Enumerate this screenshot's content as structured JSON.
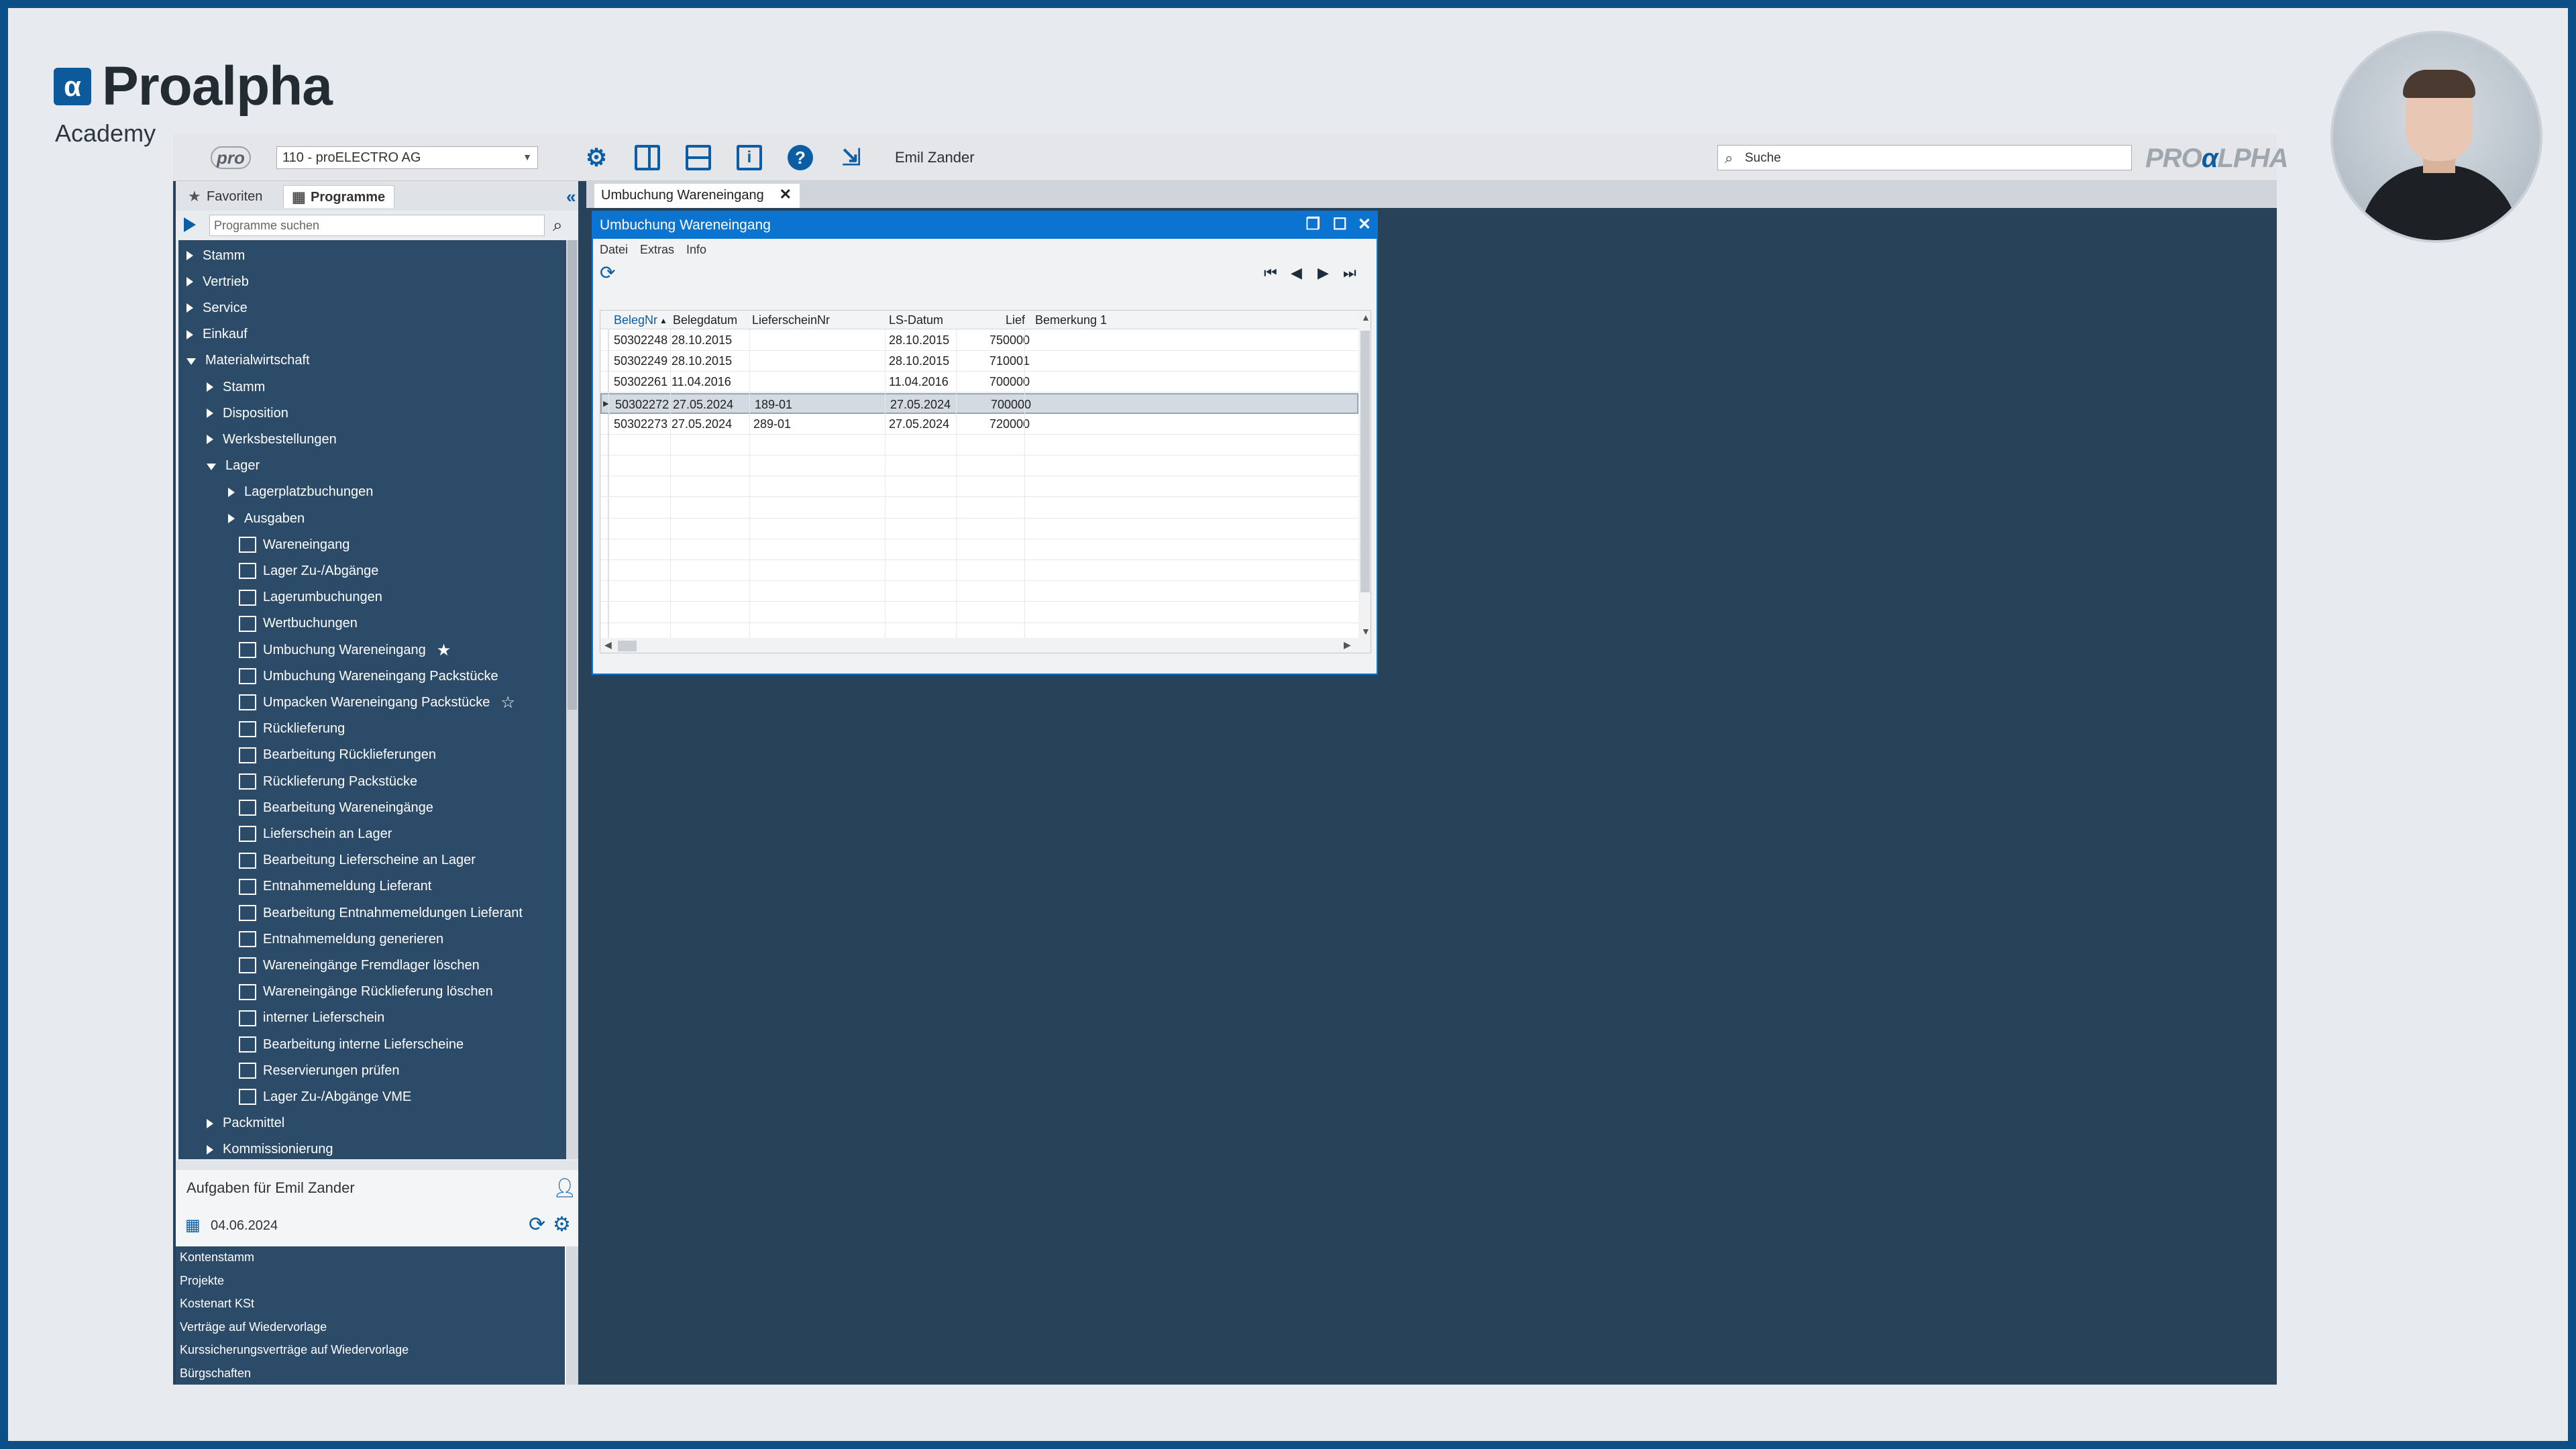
{
  "branding": {
    "logo_mark": "α",
    "logo_text": "Proalpha",
    "logo_subtitle": "Academy"
  },
  "topbar": {
    "pro_badge": "pro",
    "company_select": "110 - proELECTRO AG",
    "user_name": "Emil Zander",
    "search_placeholder": "Suche",
    "brand_left": "PRO",
    "brand_mid": "α",
    "brand_right": "LPHA",
    "icons": [
      "gear-icon",
      "panel-icon",
      "layout-icon",
      "info-icon",
      "help-icon",
      "exit-icon"
    ]
  },
  "left_panel": {
    "tab_favorites": "Favoriten",
    "tab_programs": "Programme",
    "search_placeholder": "Programme suchen",
    "tree": [
      {
        "label": "Stamm",
        "level": 0,
        "state": "collapsed"
      },
      {
        "label": "Vertrieb",
        "level": 0,
        "state": "collapsed"
      },
      {
        "label": "Service",
        "level": 0,
        "state": "collapsed"
      },
      {
        "label": "Einkauf",
        "level": 0,
        "state": "collapsed"
      },
      {
        "label": "Materialwirtschaft",
        "level": 0,
        "state": "expanded"
      },
      {
        "label": "Stamm",
        "level": 1,
        "state": "collapsed"
      },
      {
        "label": "Disposition",
        "level": 1,
        "state": "collapsed"
      },
      {
        "label": "Werksbestellungen",
        "level": 1,
        "state": "collapsed"
      },
      {
        "label": "Lager",
        "level": 1,
        "state": "expanded"
      },
      {
        "label": "Lagerplatzbuchungen",
        "level": 2,
        "state": "collapsed"
      },
      {
        "label": "Ausgaben",
        "level": 2,
        "state": "collapsed"
      },
      {
        "label": "Wareneingang",
        "level": 3,
        "state": "leaf"
      },
      {
        "label": "Lager Zu-/Abgänge",
        "level": 3,
        "state": "leaf"
      },
      {
        "label": "Lagerumbuchungen",
        "level": 3,
        "state": "leaf"
      },
      {
        "label": "Wertbuchungen",
        "level": 3,
        "state": "leaf"
      },
      {
        "label": "Umbuchung Wareneingang",
        "level": 3,
        "state": "leaf",
        "star": "filled"
      },
      {
        "label": "Umbuchung Wareneingang Packstücke",
        "level": 3,
        "state": "leaf"
      },
      {
        "label": "Umpacken Wareneingang Packstücke",
        "level": 3,
        "state": "leaf",
        "star": "outline"
      },
      {
        "label": "Rücklieferung",
        "level": 3,
        "state": "leaf"
      },
      {
        "label": "Bearbeitung Rücklieferungen",
        "level": 3,
        "state": "leaf"
      },
      {
        "label": "Rücklieferung Packstücke",
        "level": 3,
        "state": "leaf"
      },
      {
        "label": "Bearbeitung Wareneingänge",
        "level": 3,
        "state": "leaf"
      },
      {
        "label": "Lieferschein an Lager",
        "level": 3,
        "state": "leaf"
      },
      {
        "label": "Bearbeitung Lieferscheine an Lager",
        "level": 3,
        "state": "leaf"
      },
      {
        "label": "Entnahmemeldung Lieferant",
        "level": 3,
        "state": "leaf"
      },
      {
        "label": "Bearbeitung Entnahmemeldungen Lieferant",
        "level": 3,
        "state": "leaf"
      },
      {
        "label": "Entnahmemeldung generieren",
        "level": 3,
        "state": "leaf"
      },
      {
        "label": "Wareneingänge Fremdlager löschen",
        "level": 3,
        "state": "leaf"
      },
      {
        "label": "Wareneingänge Rücklieferung löschen",
        "level": 3,
        "state": "leaf"
      },
      {
        "label": "interner Lieferschein",
        "level": 3,
        "state": "leaf"
      },
      {
        "label": "Bearbeitung interne Lieferscheine",
        "level": 3,
        "state": "leaf"
      },
      {
        "label": "Reservierungen prüfen",
        "level": 3,
        "state": "leaf"
      },
      {
        "label": "Lager Zu-/Abgänge VME",
        "level": 3,
        "state": "leaf"
      },
      {
        "label": "Packmittel",
        "level": 1,
        "state": "collapsed"
      },
      {
        "label": "Kommissionierung",
        "level": 1,
        "state": "collapsed"
      }
    ]
  },
  "tasks": {
    "title": "Aufgaben für Emil Zander",
    "date": "04.06.2024",
    "items": [
      "Kontenstamm",
      "Projekte",
      "Kostenart KSt",
      "Verträge auf Wiedervorlage",
      "Kurssicherungsverträge auf Wiedervorlage",
      "Bürgschaften"
    ]
  },
  "doc_tab": {
    "label": "Umbuchung Wareneingang",
    "close": "✕"
  },
  "window": {
    "title": "Umbuchung Wareneingang",
    "menu": [
      "Datei",
      "Extras",
      "Info"
    ],
    "columns": [
      "BelegNr",
      "Belegdatum",
      "LieferscheinNr",
      "LS-Datum",
      "Lief",
      "Bemerkung 1"
    ],
    "rows": [
      {
        "belegnr": "50302248",
        "belegdatum": "28.10.2015",
        "lieferscheinnr": "",
        "lsdatum": "28.10.2015",
        "lief": "750000",
        "bemerkung": "",
        "selected": false
      },
      {
        "belegnr": "50302249",
        "belegdatum": "28.10.2015",
        "lieferscheinnr": "",
        "lsdatum": "28.10.2015",
        "lief": "710001",
        "bemerkung": "",
        "selected": false
      },
      {
        "belegnr": "50302261",
        "belegdatum": "11.04.2016",
        "lieferscheinnr": "",
        "lsdatum": "11.04.2016",
        "lief": "700000",
        "bemerkung": "",
        "selected": false
      },
      {
        "belegnr": "50302272",
        "belegdatum": "27.05.2024",
        "lieferscheinnr": "189-01",
        "lsdatum": "27.05.2024",
        "lief": "700000",
        "bemerkung": "",
        "selected": true
      },
      {
        "belegnr": "50302273",
        "belegdatum": "27.05.2024",
        "lieferscheinnr": "289-01",
        "lsdatum": "27.05.2024",
        "lief": "720000",
        "bemerkung": "",
        "selected": false
      }
    ]
  },
  "colors": {
    "accent": "#0b74d1",
    "tree_bg": "#2b4b68",
    "workspace_bg": "#28425a",
    "frame_border": "#0c4f87"
  }
}
